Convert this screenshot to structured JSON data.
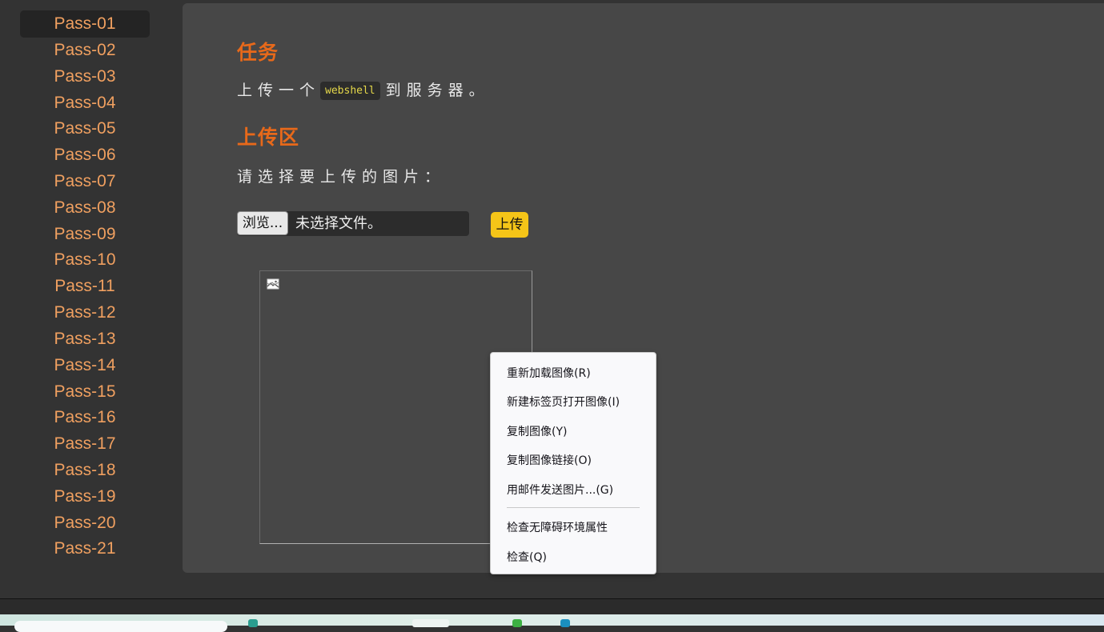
{
  "sidebar": {
    "items": [
      "Pass-01",
      "Pass-02",
      "Pass-03",
      "Pass-04",
      "Pass-05",
      "Pass-06",
      "Pass-07",
      "Pass-08",
      "Pass-09",
      "Pass-10",
      "Pass-11",
      "Pass-12",
      "Pass-13",
      "Pass-14",
      "Pass-15",
      "Pass-16",
      "Pass-17",
      "Pass-18",
      "Pass-19",
      "Pass-20",
      "Pass-21"
    ],
    "active_index": 0
  },
  "main": {
    "task_heading": "任务",
    "task_text_before": "上传一个",
    "task_code": "webshell",
    "task_text_after": "到服务器。",
    "upload_heading": "上传区",
    "prompt": "请选择要上传的图片：",
    "browse_label": "浏览...",
    "no_file_text": "未选择文件。",
    "upload_label": "上传",
    "broken_image_icon": "broken-image-icon"
  },
  "context_menu": {
    "items": [
      "重新加载图像(R)",
      "新建标签页打开图像(I)",
      "复制图像(Y)",
      "复制图像链接(O)",
      "用邮件发送图片...(G)",
      "检查无障碍环境属性",
      "检查(Q)"
    ]
  },
  "colors": {
    "accent_heading": "#e8691a",
    "sidebar_link": "#f0a060",
    "upload_button": "#f5c518",
    "code_text": "#e5d84a"
  }
}
